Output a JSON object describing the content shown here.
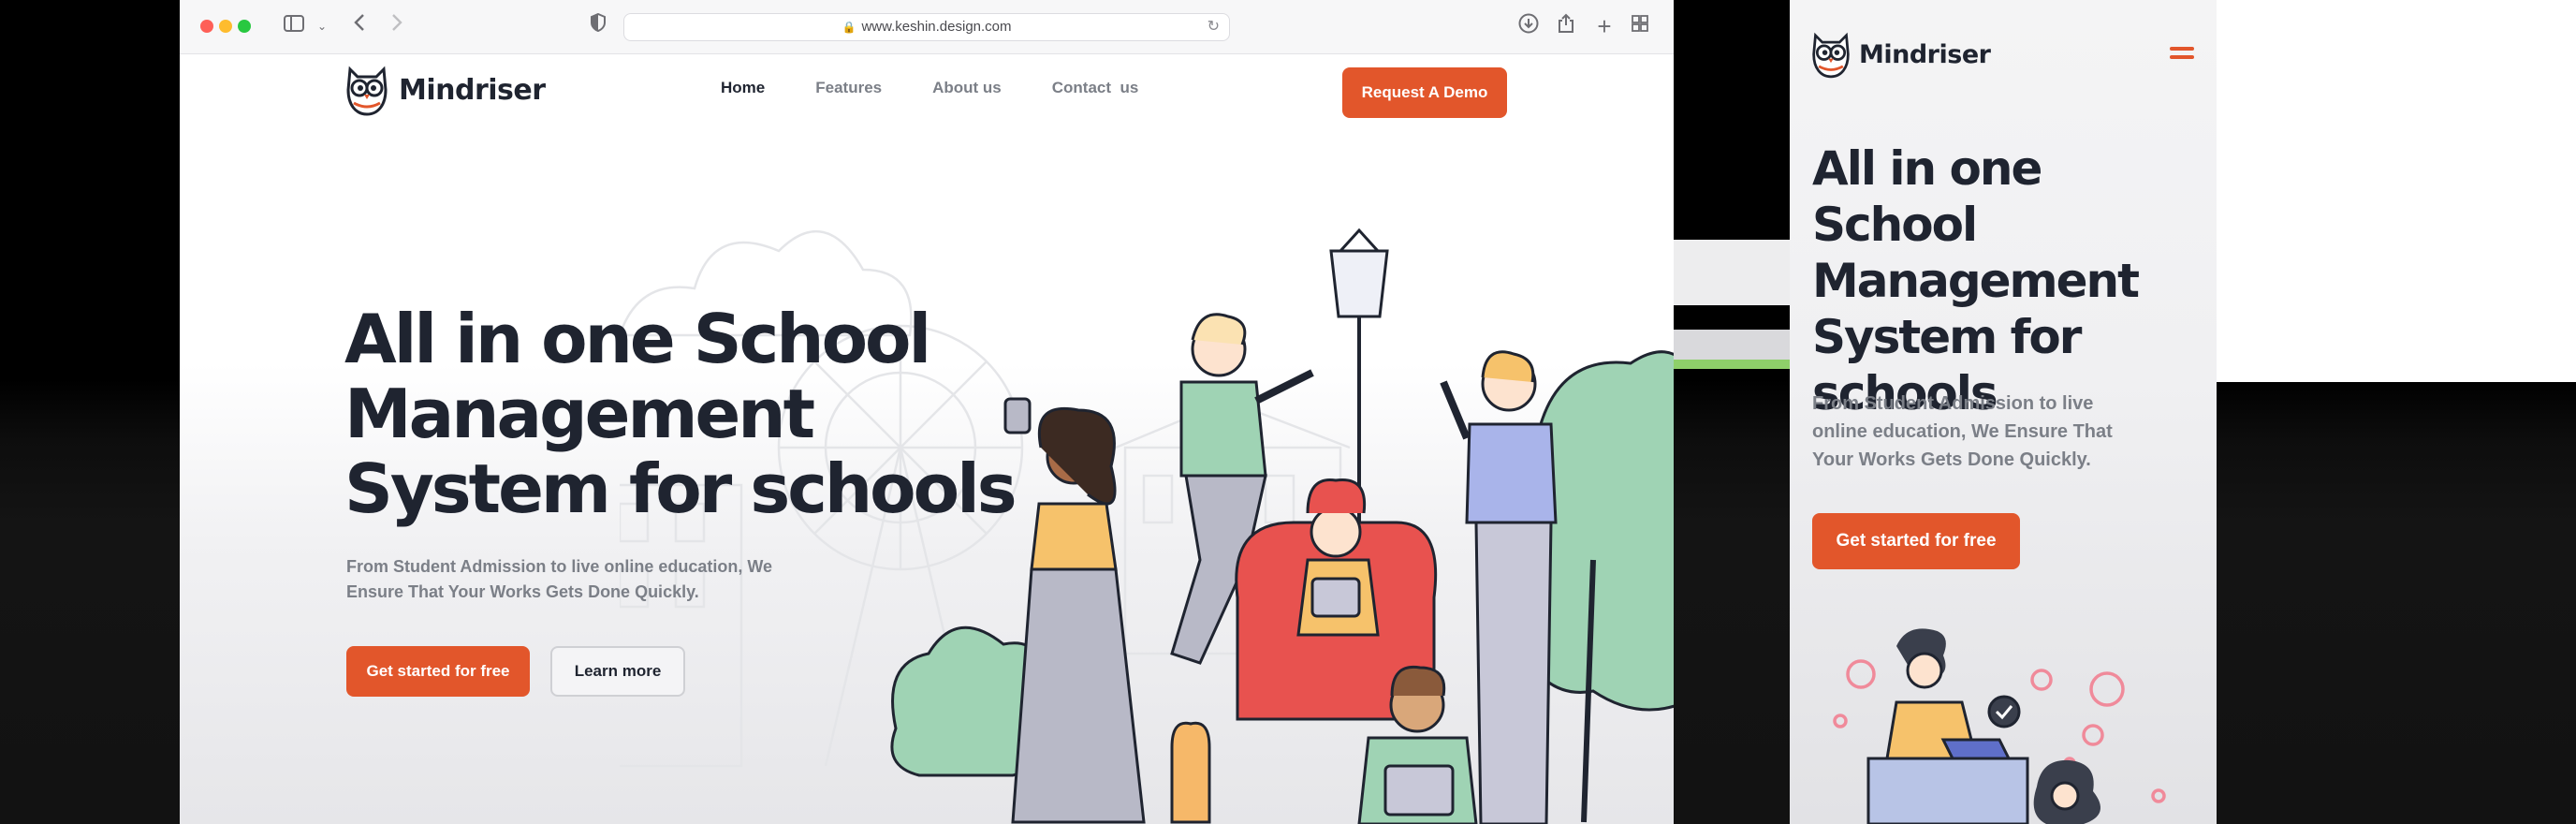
{
  "browser": {
    "url": "www.keshin.design.com",
    "toolbar_icons": [
      "sidebar-icon",
      "chevron-down-icon",
      "back-icon",
      "forward-icon",
      "shield-icon",
      "download-icon",
      "share-icon",
      "plus-icon",
      "tabs-grid-icon"
    ]
  },
  "site": {
    "brand": "Mindriser",
    "nav": [
      {
        "label": "Home",
        "active": true
      },
      {
        "label": "Features",
        "active": false
      },
      {
        "label": "About us",
        "active": false
      },
      {
        "label": "Contact  us",
        "active": false
      }
    ],
    "cta": "Request A Demo",
    "hero": {
      "title_lines": [
        "All in one School",
        "Management",
        "System for schools"
      ],
      "description": "From Student Admission to live online education, We Ensure That Your Works Gets Done Quickly.",
      "primary_button": "Get started for free",
      "secondary_button": "Learn more"
    }
  },
  "mobile": {
    "brand": "Mindriser",
    "title_lines": [
      "All in one School",
      "Management",
      "System for",
      "schools"
    ],
    "description": "From Student Admission to live online education, We Ensure That Your Works Gets Done Quickly.",
    "primary_button": "Get started for free"
  },
  "colors": {
    "accent": "#e2562b",
    "text_dark": "#1f2430",
    "text_muted": "#7b7f87"
  }
}
